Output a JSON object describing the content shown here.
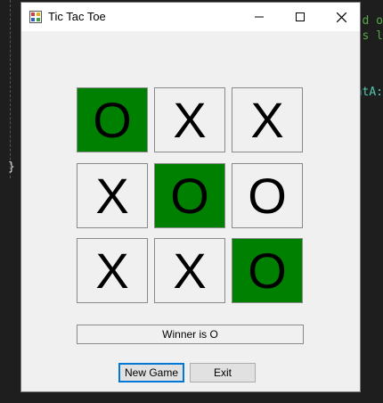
{
  "background_code": {
    "line1": "d o",
    "line2": "s l",
    "line3": "ntA:",
    "brace": "}"
  },
  "window": {
    "title": "Tic Tac Toe",
    "controls": [
      "minimize-icon",
      "maximize-icon",
      "close-icon"
    ]
  },
  "board": {
    "cells": [
      "O",
      "X",
      "X",
      "X",
      "O",
      "O",
      "X",
      "X",
      "O"
    ],
    "winning_cells": [
      0,
      4,
      8
    ],
    "win_color": "#008000"
  },
  "status": "Winner is O",
  "buttons": {
    "new_game": "New Game",
    "exit": "Exit"
  }
}
